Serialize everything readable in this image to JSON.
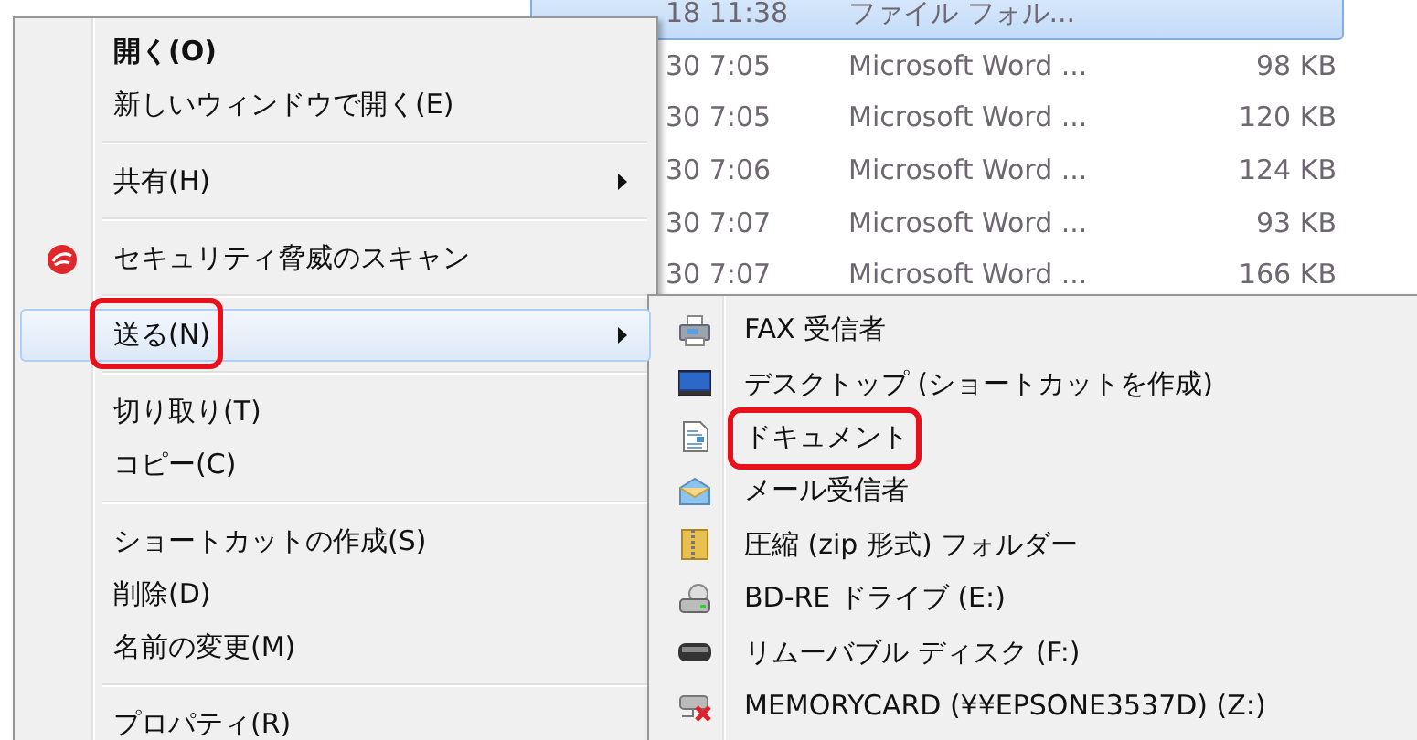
{
  "file_list": {
    "rows": [
      {
        "date": "18 11:38",
        "type": "ファイル フォル...",
        "selected": true
      },
      {
        "date": "30 7:05",
        "type": "Microsoft Word ...",
        "size": "98 KB",
        "selected": false
      },
      {
        "date": "30 7:05",
        "type": "Microsoft Word ...",
        "size": "120 KB",
        "selected": false
      },
      {
        "date": "30 7:06",
        "type": "Microsoft Word ...",
        "size": "124 KB",
        "selected": false
      },
      {
        "date": "30 7:07",
        "type": "Microsoft Word ...",
        "size": "93 KB",
        "selected": false
      },
      {
        "date": "30 7:07",
        "type": "Microsoft Word ...",
        "size": "166 KB",
        "selected": false
      }
    ]
  },
  "context_menu": {
    "items": [
      {
        "kind": "item",
        "label": "開く(O)",
        "bold": true,
        "submenu": false,
        "selected": false,
        "annotated": false
      },
      {
        "kind": "item",
        "label": "新しいウィンドウで開く(E)",
        "bold": false,
        "submenu": false,
        "selected": false,
        "annotated": false
      },
      {
        "kind": "separator"
      },
      {
        "kind": "item",
        "label": "共有(H)",
        "bold": false,
        "submenu": true,
        "selected": false,
        "annotated": false
      },
      {
        "kind": "separator"
      },
      {
        "kind": "item",
        "label": "セキュリティ脅威のスキャン",
        "bold": false,
        "submenu": false,
        "selected": false,
        "annotated": false
      },
      {
        "kind": "separator"
      },
      {
        "kind": "item",
        "label": "送る(N)",
        "bold": false,
        "submenu": true,
        "selected": true,
        "annotated": true
      },
      {
        "kind": "separator"
      },
      {
        "kind": "item",
        "label": "切り取り(T)",
        "bold": false,
        "submenu": false,
        "selected": false,
        "annotated": false
      },
      {
        "kind": "item",
        "label": "コピー(C)",
        "bold": false,
        "submenu": false,
        "selected": false,
        "annotated": false
      },
      {
        "kind": "separator"
      },
      {
        "kind": "item",
        "label": "ショートカットの作成(S)",
        "bold": false,
        "submenu": false,
        "selected": false,
        "annotated": false
      },
      {
        "kind": "item",
        "label": "削除(D)",
        "bold": false,
        "submenu": false,
        "selected": false,
        "annotated": false
      },
      {
        "kind": "item",
        "label": "名前の変更(M)",
        "bold": false,
        "submenu": false,
        "selected": false,
        "annotated": false
      },
      {
        "kind": "separator"
      },
      {
        "kind": "item",
        "label": "プロパティ(R)",
        "bold": false,
        "submenu": false,
        "selected": false,
        "annotated": false
      }
    ]
  },
  "send_to_menu": {
    "items": [
      {
        "label": "FAX 受信者",
        "annotated": false
      },
      {
        "label": "デスクトップ (ショートカットを作成)",
        "annotated": false
      },
      {
        "label": "ドキュメント",
        "annotated": true
      },
      {
        "label": "メール受信者",
        "annotated": false
      },
      {
        "label": "圧縮 (zip 形式) フォルダー",
        "annotated": false
      },
      {
        "label": "BD-RE ドライブ (E:)",
        "annotated": false
      },
      {
        "label": "リムーバブル ディスク (F:)",
        "annotated": false
      },
      {
        "label": "MEMORYCARD (¥¥EPSONE3537D) (Z:)",
        "annotated": false
      }
    ]
  }
}
